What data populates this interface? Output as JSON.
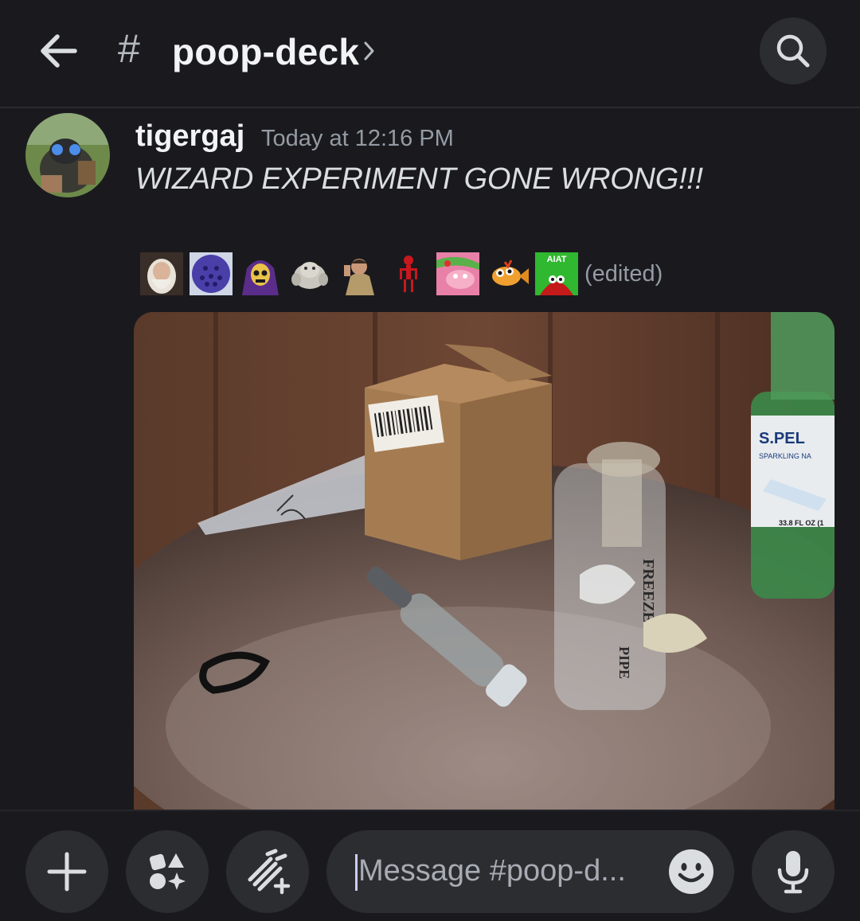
{
  "header": {
    "hash_symbol": "#",
    "channel_name": "poop-deck",
    "chevron": "›"
  },
  "message": {
    "username": "tigergaj",
    "timestamp": "Today at 12:16 PM",
    "text": "WIZARD EXPERIMENT GONE WRONG!!!",
    "edited_label": "(edited)",
    "inline_emojis": [
      "wizard-emoji",
      "purple-face-emoji",
      "skeletor-emoji",
      "stone-creature-emoji",
      "detective-emoji",
      "red-skeleton-emoji",
      "pink-creature-emoji",
      "fish-emoji",
      "aiat-emoji"
    ],
    "emoji_label": "AIAT",
    "photo_labels": {
      "brand": "S.PEL",
      "sub": "SPARKLING NA",
      "volume": "33.8 FL OZ (1",
      "pipe_text_1": "FREEZE",
      "pipe_text_2": "PIPE"
    }
  },
  "composer": {
    "placeholder": "Message #poop-d..."
  },
  "icons": {
    "back": "arrow-left-icon",
    "search": "search-icon",
    "add": "plus-icon",
    "apps": "apps-icon",
    "gift": "wand-icon",
    "emoji": "emoji-icon",
    "mic": "microphone-icon"
  },
  "colors": {
    "background": "#1a1a1e",
    "button_bg": "#2b2d31",
    "text_primary": "#f2f3f5",
    "text_muted": "#949ba4"
  }
}
